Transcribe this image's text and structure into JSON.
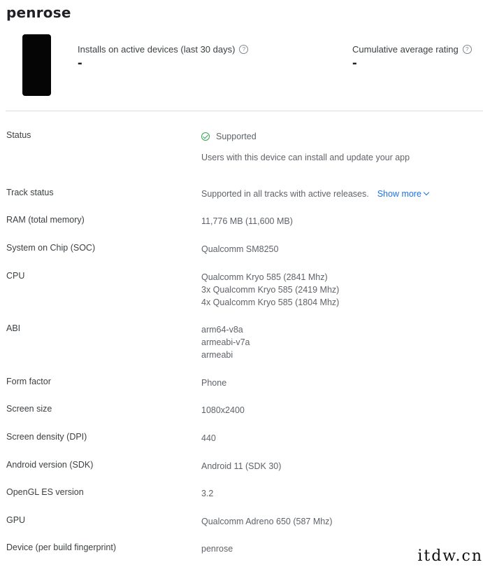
{
  "header": {
    "device_name": "penrose"
  },
  "metrics": [
    {
      "label": "Installs on active devices (last 30 days)",
      "value": "-",
      "help_icon": "help-circle-icon"
    },
    {
      "label": "Cumulative average rating",
      "value": "-",
      "help_icon": "help-circle-icon"
    }
  ],
  "status": {
    "label": "Status",
    "value": "Supported",
    "icon": "check-circle-icon",
    "description": "Users with this device can install and update your app",
    "color": "#34a853"
  },
  "track_status": {
    "label": "Track status",
    "value": "Supported in all tracks with active releases.",
    "link": "Show more",
    "link_color": "#1a73e8"
  },
  "specs": [
    {
      "label": "RAM (total memory)",
      "values": [
        "11,776 MB (11,600 MB)"
      ]
    },
    {
      "label": "System on Chip (SOC)",
      "values": [
        "Qualcomm SM8250"
      ]
    },
    {
      "label": "CPU",
      "values": [
        "Qualcomm Kryo 585 (2841 Mhz)",
        "3x Qualcomm Kryo 585 (2419 Mhz)",
        "4x Qualcomm Kryo 585 (1804 Mhz)"
      ]
    },
    {
      "label": "ABI",
      "values": [
        "arm64-v8a",
        "armeabi-v7a",
        "armeabi"
      ]
    },
    {
      "label": "Form factor",
      "values": [
        "Phone"
      ]
    },
    {
      "label": "Screen size",
      "values": [
        "1080x2400"
      ]
    },
    {
      "label": "Screen density (DPI)",
      "values": [
        "440"
      ]
    },
    {
      "label": "Android version (SDK)",
      "values": [
        "Android 11 (SDK 30)"
      ]
    },
    {
      "label": "OpenGL ES version",
      "values": [
        "3.2"
      ]
    },
    {
      "label": "GPU",
      "values": [
        "Qualcomm Adreno 650 (587 Mhz)"
      ]
    },
    {
      "label": "Device (per build fingerprint)",
      "values": [
        "penrose"
      ]
    }
  ],
  "watermark": "itdw.cn"
}
